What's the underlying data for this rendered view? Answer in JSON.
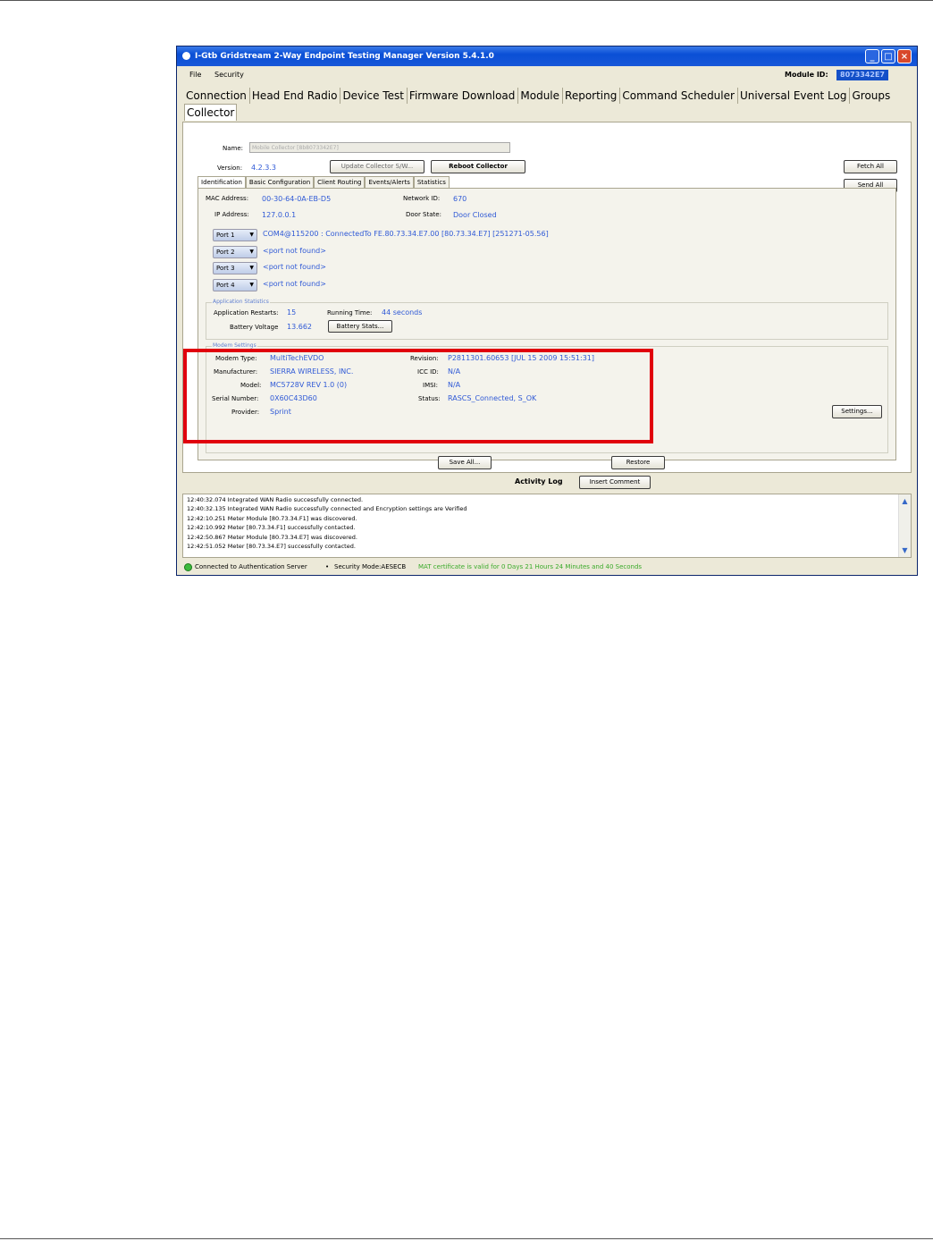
{
  "window": {
    "title": "I-Gtb Gridstream 2-Way Endpoint Testing Manager Version 5.4.1.0",
    "min_glyph": "_",
    "max_glyph": "□",
    "close_glyph": "×"
  },
  "menu": {
    "items": [
      "File",
      "Security"
    ]
  },
  "module_id": {
    "label": "Module ID:",
    "value": "8073342E7"
  },
  "main_tabs": {
    "row1": [
      "Connection",
      "Head End Radio",
      "Device Test",
      "Firmware Download",
      "Module",
      "Reporting",
      "Command Scheduler",
      "Universal Event Log",
      "Groups"
    ],
    "row2": [
      "Collector"
    ]
  },
  "collector": {
    "name_label": "Name:",
    "name_value": "Mobile Collector [8b8073342E7]",
    "version_label": "Version:",
    "version_value": "4.2.3.3",
    "update_button": "Update Collector S/W...",
    "reboot_button": "Reboot Collector",
    "fetch_all_button": "Fetch All",
    "send_all_button": "Send All"
  },
  "sub_tabs": [
    "Identification",
    "Basic Configuration",
    "Client Routing",
    "Events/Alerts",
    "Statistics"
  ],
  "identification": {
    "mac_label": "MAC Address:",
    "mac_value": "00-30-64-0A-EB-D5",
    "ip_label": "IP Address:",
    "ip_value": "127.0.0.1",
    "network_label": "Network ID:",
    "network_value": "670",
    "door_label": "Door State:",
    "door_value": "Door Closed",
    "ports": [
      {
        "label": "Port 1",
        "value": "COM4@115200 : ConnectedTo FE.80.73.34.E7.00 [80.73.34.E7]  [251271-05.56]"
      },
      {
        "label": "Port 2",
        "value": "<port not found>"
      },
      {
        "label": "Port 3",
        "value": "<port not found>"
      },
      {
        "label": "Port 4",
        "value": "<port not found>"
      }
    ],
    "port_arrow": "▼"
  },
  "app_stats": {
    "title": "Application Statistics",
    "restarts_label": "Application Restarts:",
    "restarts_value": "15",
    "running_label": "Running Time:",
    "running_value": "44 seconds",
    "battery_label": "Battery Voltage",
    "battery_value": "13.662",
    "battery_button": "Battery Stats..."
  },
  "modem": {
    "title": "Modem Settings",
    "type_label": "Modem Type:",
    "type_value": "MultiTechEVDO",
    "manufacturer_label": "Manufacturer:",
    "manufacturer_value": "SIERRA WIRELESS, INC.",
    "model_label": "Model:",
    "model_value": "MC5728V REV 1.0 (0)",
    "serial_label": "Serial Number:",
    "serial_value": "0X60C43D60",
    "provider_label": "Provider:",
    "provider_value": "Sprint",
    "revision_label": "Revision:",
    "revision_value": "P2811301.60653 [JUL 15 2009 15:51:31]",
    "icc_label": "ICC ID:",
    "icc_value": "N/A",
    "imsi_label": "IMSI:",
    "imsi_value": "N/A",
    "status_label": "Status:",
    "status_value": "RASCS_Connected, S_OK",
    "settings_button": "Settings..."
  },
  "actions": {
    "save_all": "Save All...",
    "restore": "Restore"
  },
  "activity_log": {
    "title": "Activity Log",
    "insert_comment": "Insert Comment",
    "lines": [
      "12:40:32.074 Integrated WAN Radio successfully connected.",
      "12:40:32.135 Integrated WAN Radio successfully connected and Encryption settings are Verified",
      "12:42:10.251 Meter Module [80.73.34.F1] was discovered.",
      "12:42:10.992 Meter [80.73.34.F1] successfully contacted.",
      "12:42:50.867 Meter Module [80.73.34.E7] was discovered.",
      "12:42:51.052 Meter [80.73.34.E7] successfully contacted."
    ],
    "scroll_up": "▲",
    "scroll_down": "▼"
  },
  "status": {
    "connection": "Connected to Authentication Server",
    "separator": "•",
    "security_mode": "Security Mode:AESECB",
    "certificate": "MAT certificate is valid for 0 Days 21 Hours 24 Minutes and 40 Seconds",
    "certificate_color": "#3aaa2a"
  },
  "colors": {
    "value_text": "#2f59d6",
    "highlight": "#e0000d",
    "titlebar": "#0a4fd6"
  }
}
